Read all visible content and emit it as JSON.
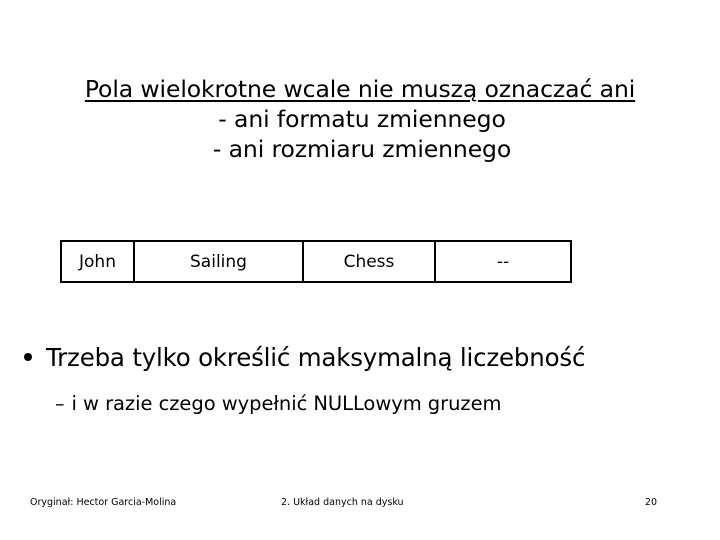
{
  "slide": {
    "background_color": "#ffffff",
    "text_color": "#000000",
    "title": {
      "line1": "Pola wielokrotne wcale nie muszą oznaczać ani",
      "line2": "- ani formatu zmiennego",
      "line3": "- ani rozmiaru zmiennego"
    },
    "table": {
      "columns": [
        "John",
        "Sailing",
        "Chess",
        "--"
      ],
      "border_color": "#000000"
    },
    "bullets": {
      "main_marker": "bullet-dot",
      "main": "Trzeba tylko określić maksymalną liczebność",
      "sub_marker": "–",
      "sub": "i w razie czego wypełnić NULLowym gruzem"
    },
    "footer": {
      "credit": "Oryginał: Hector Garcia-Molina",
      "section": "2. Układ danych na dysku",
      "page_number": "20"
    }
  }
}
